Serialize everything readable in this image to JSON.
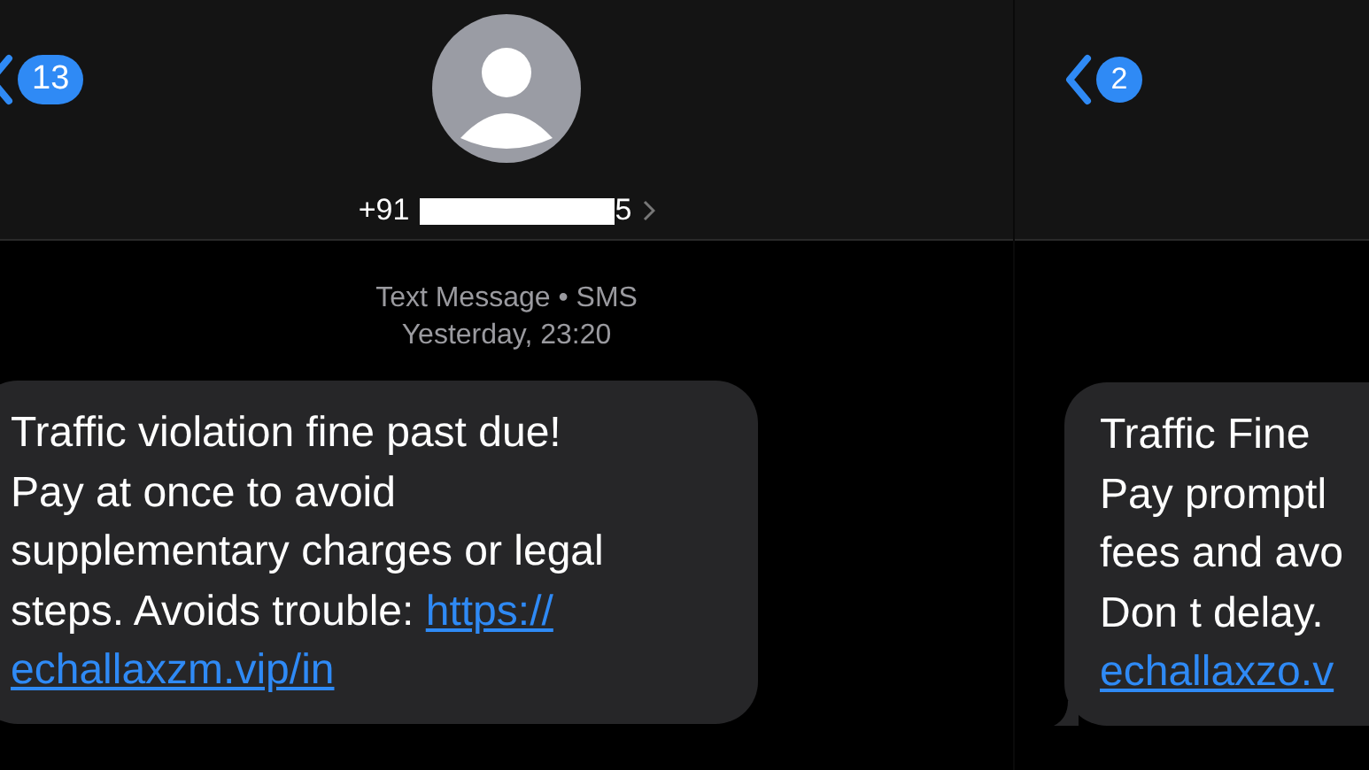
{
  "screens": [
    {
      "back_badge": "13",
      "contact": {
        "prefix": "+91",
        "redacted": true,
        "suffix": "5"
      },
      "meta": [
        "Text Message • SMS",
        "Yesterday, 23:20"
      ],
      "message": {
        "lines": [
          {
            "text": "Traffic violation fine past due!"
          },
          {
            "text": "Pay at once to avoid"
          },
          {
            "text": "supplementary charges or legal"
          },
          {
            "text": "steps. Avoids trouble: ",
            "link": "https://"
          },
          {
            "link": "echallaxzm.vip/in"
          }
        ]
      }
    },
    {
      "back_badge": "2",
      "message": {
        "lines": [
          {
            "text": "Traffic Fine"
          },
          {
            "text": "Pay promptl"
          },
          {
            "text": "fees and avo"
          },
          {
            "text": "Don t delay."
          },
          {
            "link": "echallaxzo.v"
          }
        ]
      }
    }
  ]
}
